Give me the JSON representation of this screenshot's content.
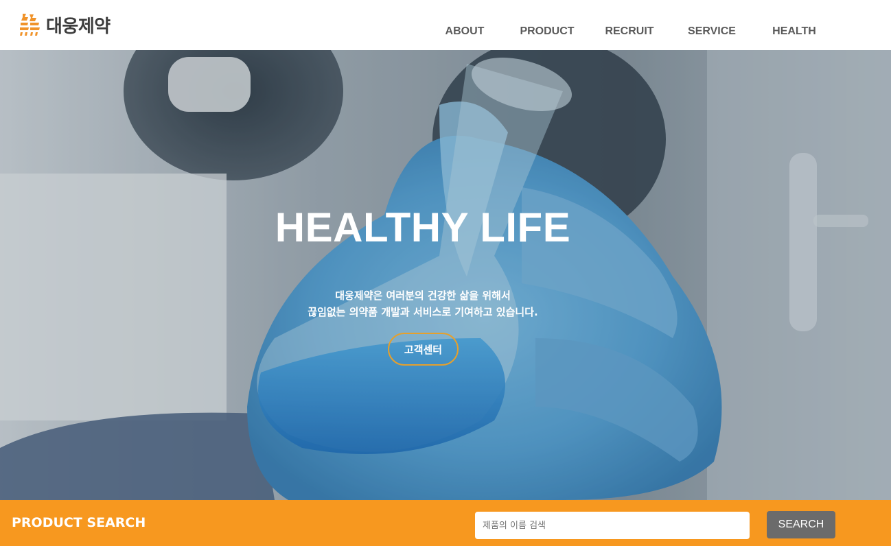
{
  "brand": {
    "name": "대웅제약",
    "accent": "#f7981f",
    "logo_icon": "bear-logo-icon"
  },
  "nav": {
    "items": [
      {
        "label": "ABOUT"
      },
      {
        "label": "PRODUCT"
      },
      {
        "label": "RECRUIT"
      },
      {
        "label": "SERVICE"
      },
      {
        "label": "HEALTH"
      }
    ]
  },
  "hero": {
    "title": "HEALTHY LIFE",
    "desc_line1": "대웅제약은 여러분의 건강한 삶을 위해서",
    "desc_line2": "끊임없는 의약품 개발과 서비스로 기여하고 있습니다.",
    "cta_label": "고객센터",
    "cta_border_color": "#e6a02c",
    "background_image": "scientist-holding-flask-photo"
  },
  "product_search": {
    "title": "PRODUCT SEARCH",
    "placeholder": "제품의 이름 검색",
    "value": "",
    "button_label": "SEARCH",
    "bar_color": "#f7981f",
    "button_color": "#6b6b6b"
  }
}
